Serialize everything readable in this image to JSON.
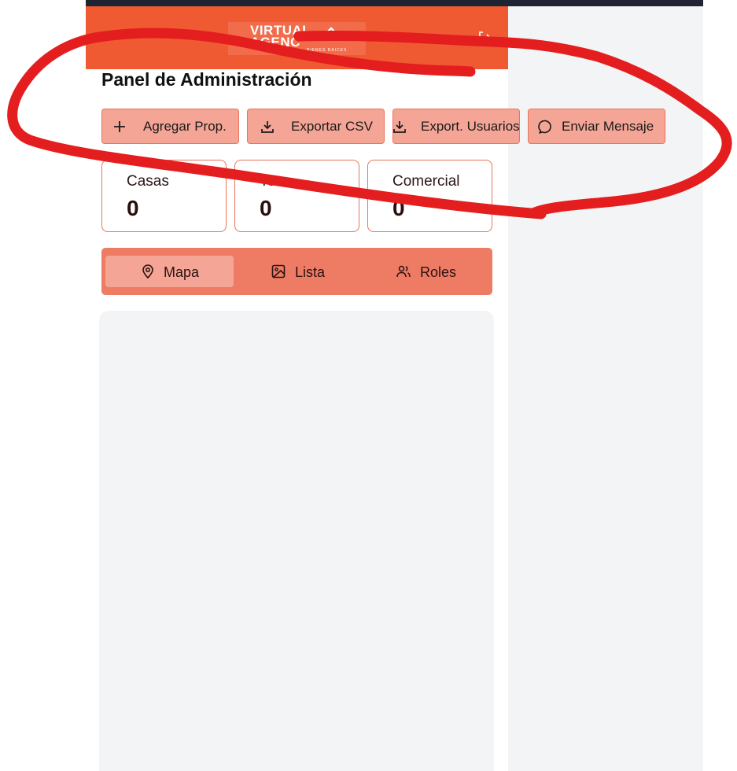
{
  "header": {
    "logo_line1": "VIRTUAL",
    "logo_line2": "AGENC",
    "logo_tagline": "BIENES RAICES",
    "logout_icon": "logout-icon"
  },
  "page": {
    "title": "Panel de Administración"
  },
  "actions": [
    {
      "label": "Agregar Prop.",
      "icon": "plus-icon"
    },
    {
      "label": "Exportar CSV",
      "icon": "download-icon"
    },
    {
      "label": "Export. Usuarios",
      "icon": "download-icon"
    },
    {
      "label": "Enviar Mensaje",
      "icon": "message-circle-icon"
    }
  ],
  "stats": [
    {
      "label": "Casas",
      "value": "0"
    },
    {
      "label": "Terr",
      "value": "0"
    },
    {
      "label": "Comercial",
      "value": "0"
    }
  ],
  "tabs": [
    {
      "label": "Mapa",
      "icon": "map-pin-icon",
      "active": true
    },
    {
      "label": "Lista",
      "icon": "image-icon",
      "active": false
    },
    {
      "label": "Roles",
      "icon": "users-icon",
      "active": false
    }
  ],
  "colors": {
    "brand_orange": "#ef5a32",
    "button_fill": "#f4a596",
    "button_border": "#e7755c",
    "tab_bar": "#ee7c64",
    "annotation_red": "#e41e1e"
  }
}
